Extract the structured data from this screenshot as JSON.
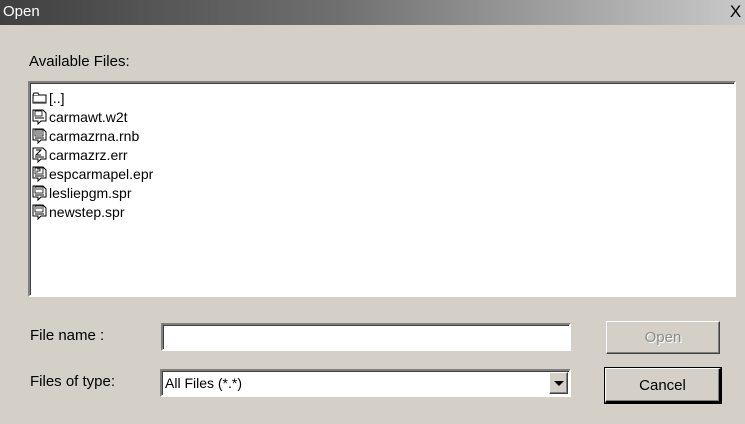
{
  "window": {
    "title": "Open",
    "close_label": "X"
  },
  "available_files_label": "Available Files:",
  "files": [
    {
      "name": "[..]",
      "icon": "folder-icon"
    },
    {
      "name": "carmawt.w2t",
      "icon": "w2t-file-icon"
    },
    {
      "name": "carmazrna.rnb",
      "icon": "rnb-file-icon"
    },
    {
      "name": "carmazrz.err",
      "icon": "err-file-icon"
    },
    {
      "name": "espcarmapel.epr",
      "icon": "epr-file-icon"
    },
    {
      "name": "lesliepgm.spr",
      "icon": "spr-file-icon"
    },
    {
      "name": "newstep.spr",
      "icon": "spr-file-icon"
    }
  ],
  "file_name": {
    "label": "File name :",
    "value": ""
  },
  "file_type": {
    "label": "Files of type:",
    "value": "All Files (*.*)"
  },
  "buttons": {
    "open": "Open",
    "cancel": "Cancel"
  }
}
